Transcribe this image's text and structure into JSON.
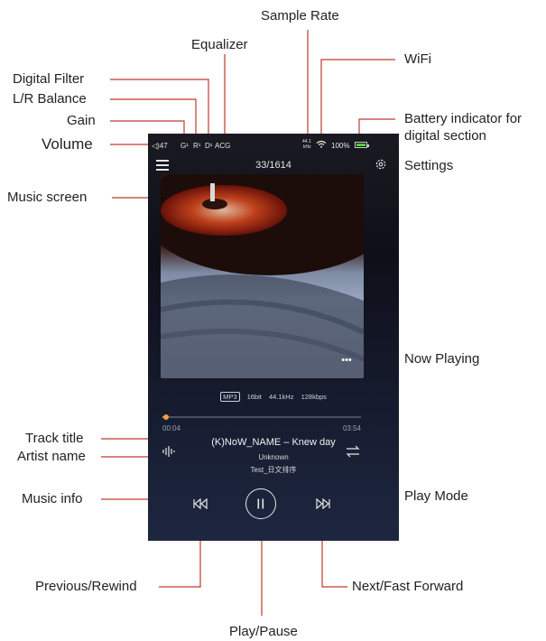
{
  "callouts": {
    "sample_rate": "Sample Rate",
    "equalizer": "Equalizer",
    "wifi": "WiFi",
    "digital_filter": "Digital Filter",
    "lr_balance": "L/R Balance",
    "gain": "Gain",
    "volume": "Volume",
    "battery_line1": "Battery indicator for",
    "battery_line2": "digital section",
    "settings": "Settings",
    "music_screen": "Music screen",
    "now_playing": "Now Playing",
    "track_title": "Track title",
    "artist_name": "Artist name",
    "music_info": "Music info",
    "play_mode": "Play Mode",
    "previous": "Previous/Rewind",
    "next": "Next/Fast Forward",
    "play_pause": "Play/Pause"
  },
  "status_bar": {
    "volume": "◁)47",
    "gain": "G¹",
    "balance": "R¹",
    "filter": "D¹",
    "eq": "ACG",
    "sample_rate_top": "44.1",
    "sample_rate_unit": "kHz",
    "battery_pct": "100%"
  },
  "header": {
    "counter": "33/1614"
  },
  "player": {
    "more": "•••",
    "format_badge": "MP3",
    "bit_depth": "16bit",
    "sample_rate": "44.1kHz",
    "bitrate": "128kbps",
    "elapsed": "00:04",
    "total": "03:54",
    "progress_fraction": 0.017,
    "title": "(K)NoW_NAME – Knew day",
    "artist": "Unknown",
    "album": "Test_日文排序"
  },
  "colors": {
    "accent": "#d8892b",
    "callout_line": "#c0392b",
    "battery": "#4cd137"
  },
  "icons": [
    "menu-icon",
    "gear-icon",
    "wifi-icon",
    "battery-icon",
    "more-icon",
    "music-info-icon",
    "play-mode-icon",
    "previous-icon",
    "play-pause-icon",
    "next-icon"
  ]
}
